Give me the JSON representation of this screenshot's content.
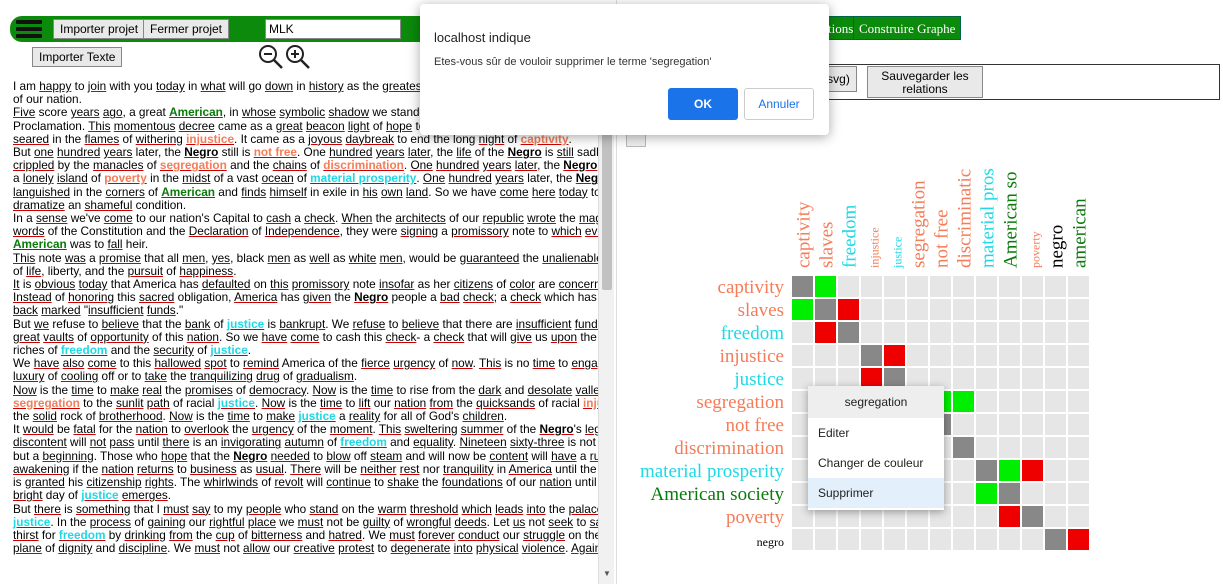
{
  "toolbar": {
    "import_project": "Importer projet",
    "close_project": "Fermer projet",
    "project_name": "MLK",
    "import_text": "Importer Texte"
  },
  "graph": {
    "relations_partial": "tions",
    "build_graph": "Construire Graphe",
    "save_svg_partial": "(svg)",
    "save_relations": "Sauvegarder les relations"
  },
  "dialog": {
    "title": "localhost indique",
    "message": "Etes-vous sûr de vouloir supprimer le terme 'segregation'",
    "ok": "OK",
    "cancel": "Annuler"
  },
  "context_menu": {
    "header": "segregation",
    "items": [
      "Editer",
      "Changer de couleur",
      "Supprimer"
    ]
  },
  "colors": {
    "red": "#f47c58",
    "cyan": "#1fd8e6",
    "green": "#0a7a0a",
    "black": "#000000",
    "grey_cell": "#888888",
    "empty_cell": "#e6e6e6",
    "green_cell": "#00ee00",
    "red_cell": "#ee0000"
  },
  "icons": [
    "menu-icon",
    "zoom-out-icon",
    "zoom-in-icon"
  ],
  "terms": [
    {
      "label": "captivity",
      "color": "red",
      "size": "big"
    },
    {
      "label": "slaves",
      "color": "red",
      "size": "big"
    },
    {
      "label": "freedom",
      "color": "cyan",
      "size": "big"
    },
    {
      "label": "injustice",
      "color": "red",
      "size": "small"
    },
    {
      "label": "justice",
      "color": "cyan",
      "size": "small"
    },
    {
      "label": "segregation",
      "color": "red",
      "size": "big"
    },
    {
      "label": "not free",
      "color": "red",
      "size": "big"
    },
    {
      "label": "discrimination",
      "color": "red",
      "size": "big"
    },
    {
      "label": "material prosperity",
      "color": "cyan",
      "size": "big"
    },
    {
      "label": "American society",
      "color": "green",
      "size": "big"
    },
    {
      "label": "poverty",
      "color": "red",
      "size": "small"
    },
    {
      "label": "negro",
      "color": "black",
      "size": "big"
    },
    {
      "label": "american",
      "color": "green",
      "size": "big"
    }
  ],
  "column_labels": [
    "captivity",
    "slaves",
    "freedom",
    "injustice",
    "justice",
    "segregation",
    "not free",
    "discriminatic",
    "material pros",
    "American so",
    "poverty",
    "negro",
    "american"
  ],
  "row_labels": [
    "captivity",
    "slaves",
    "freedom",
    "injustice",
    "justice",
    "segregation",
    "not free",
    "discrimination",
    "material prosperity",
    "American society",
    "poverty",
    "negro"
  ],
  "cells": [
    {
      "r": 0,
      "c": 0,
      "s": "grey"
    },
    {
      "r": 0,
      "c": 1,
      "s": "green"
    },
    {
      "r": 1,
      "c": 0,
      "s": "green"
    },
    {
      "r": 1,
      "c": 1,
      "s": "grey"
    },
    {
      "r": 1,
      "c": 2,
      "s": "red"
    },
    {
      "r": 2,
      "c": 1,
      "s": "red"
    },
    {
      "r": 2,
      "c": 2,
      "s": "grey"
    },
    {
      "r": 3,
      "c": 3,
      "s": "grey"
    },
    {
      "r": 3,
      "c": 4,
      "s": "red"
    },
    {
      "r": 4,
      "c": 3,
      "s": "red"
    },
    {
      "r": 4,
      "c": 4,
      "s": "grey"
    },
    {
      "r": 5,
      "c": 5,
      "s": "grey"
    },
    {
      "r": 5,
      "c": 6,
      "s": "green"
    },
    {
      "r": 5,
      "c": 7,
      "s": "green"
    },
    {
      "r": 6,
      "c": 6,
      "s": "grey"
    },
    {
      "r": 7,
      "c": 7,
      "s": "grey"
    },
    {
      "r": 8,
      "c": 8,
      "s": "grey"
    },
    {
      "r": 8,
      "c": 9,
      "s": "green"
    },
    {
      "r": 8,
      "c": 10,
      "s": "red"
    },
    {
      "r": 9,
      "c": 8,
      "s": "green"
    },
    {
      "r": 9,
      "c": 9,
      "s": "grey"
    },
    {
      "r": 10,
      "c": 9,
      "s": "red"
    },
    {
      "r": 10,
      "c": 10,
      "s": "grey"
    },
    {
      "r": 11,
      "c": 11,
      "s": "grey"
    },
    {
      "r": 11,
      "c": 12,
      "s": "red"
    }
  ],
  "text_lines": [
    "I am [happy] to [join] with you [today] in [what] will go [down] in [history] as the [greatest] [dem]",
    "of our nation.",
    "[Five] score [years] [ago], a great {g:American}, in [whose] [symbolic] [shadow] we stand [today]",
    "Proclamation. [This] [momentous] [decree] came as a [great] [beacon] [light] of [hope] to [milli]",
    "[seared] in the [flames] of [withering] {r:injustice}. It came as a [joyous] [daybreak] to end the long [night] of {r:captivity}.",
    "But [one] [hundred] [years] later, the {b:Negro} still is {r:not free}. One [hundred] [years] [later], the [life] of the {b:Negro} is [still] sadly",
    "[crippled] by the [manacles] of {r:segregation} and the [chains] of {r:discrimination}. [One] [hundred] [years] [later], the {b:Negro} lives on",
    "a [lonely] [island] of {r:poverty} in the [midst] of a vast [ocean] of {c:material prosperity}. [One] [hundred] [years] later, the {b:Negro} is [still]",
    "[languished] in the [corners] of {g:American} and [finds] [himself] in exile in [his] [own] [land]. So we have [come] [here] [today] to",
    "[dramatize] an [shameful] condition.",
    "In a [sense] we've [come] to our nation's Capital to [cash] a [check]. [When] the [architects] of our [republic] [wrote] the [magnificent]",
    "[words] of the Constitution and the [Declaration] of [Independence], they were [signing] a [promissory] note to [which] [every]",
    "{g:American} was to [fall] heir.",
    "[This] note [was] a [promise] that all [men], [yes], black [men] as [well] as [white] [men], would be [guaranteed] the [unalienable] [rights]",
    "of [life], liberty, and the [pursuit] of [happiness].",
    "[It] is [obvious] [today] that America has [defaulted] on [this] [promissory] note [insofar] as her [citizens] of [color] are [concerned].",
    "[Instead] of [honoring] this [sacred] obligation, [America] has [given] the {b:Negro} people a [bad] [check]; a [check] which has [come]",
    "[back] [marked] \"[insufficient] [funds].\"",
    "But [we] refuse to [believe] that the [bank] of {c:justice} is [bankrupt]. We [refuse] to [believe] that there are [insufficient] [funds] in the",
    "[great] [vaults] of [opportunity] of this [nation]. So we [have] [come] to cash this [check]- a [check] that will [give] us [upon] the [demand]",
    "riches of {c:freedom} and the [security] of {c:justice}.",
    "We [have] [also] [come] to this [hallowed] [spot] to [remind] America of the [fierce] [urgency] of [now]. [This] is no [time] to [engage] in the",
    "[luxury] of [cooling] off or to [take] the [tranquilizing] [drug] of [gradualism].",
    "[Now] is the [time] to [make] [real] the [promises] of [democracy]. [Now] is the [time] to rise from the [dark] and [desolate] [valley] of",
    "{r:segregation} to the [sunlit] [path] of racial {c:justice}. [Now] is the [time] to [lift] our [nation] [from] the [quicksands] of racial {r:injustice} to",
    "the [solid] rock of [brotherhood]. [Now] is the [time] to [make] {c:justice} a [reality] for all of God's [children].",
    "It [would] be [fatal] for the [nation] to [overlook] the [urgency] of the [moment]. [This] [sweltering] [summer] of the {b:Negro}'s [legitimate]",
    "[discontent] will [not] [pass] until [there] is an [invigorating] [autumn] of {c:freedom} and [equality]. [Nineteen] [sixty-three] is not an [end],",
    "but a [beginning]. Those who [hope] that the {b:Negro} [needed] to [blow] off [steam] and will now be [content] will [have] a [rude]",
    "[awakening] if the [nation] [returns] to [business] as [usual]. [There] will be [neither] [rest] nor [tranquility] in [America] until the {b:Negro}",
    "is [granted] his [citizenship] [rights]. The [whirlwinds] of [revolt] will [continue] to [shake] the [foundations] of our [nation] until the",
    "[bright] day of {c:justice} [emerges].",
    "But [there] is [something] that I [must] [say] to my [people] who [stand] on the [warm] [threshold] [which] [leads] [into] the [palace] of",
    "{c:justice}. In the [process] of [gaining] our [rightful] [place] we [must] not be [guilty] of [wrongful] [deeds]. Let [us] not [seek] to [satisfy] our",
    "[thirst] for {c:freedom} by [drinking] [from] the [cup] of [bitterness] and [hatred]. We [must] [forever] [conduct] our [struggle] on the [high]",
    "[plane] of [dignity] and [discipline]. We [must] not [allow] our [creative] [protest] to [degenerate] [into] [physical] [violence]. [Again] and"
  ]
}
